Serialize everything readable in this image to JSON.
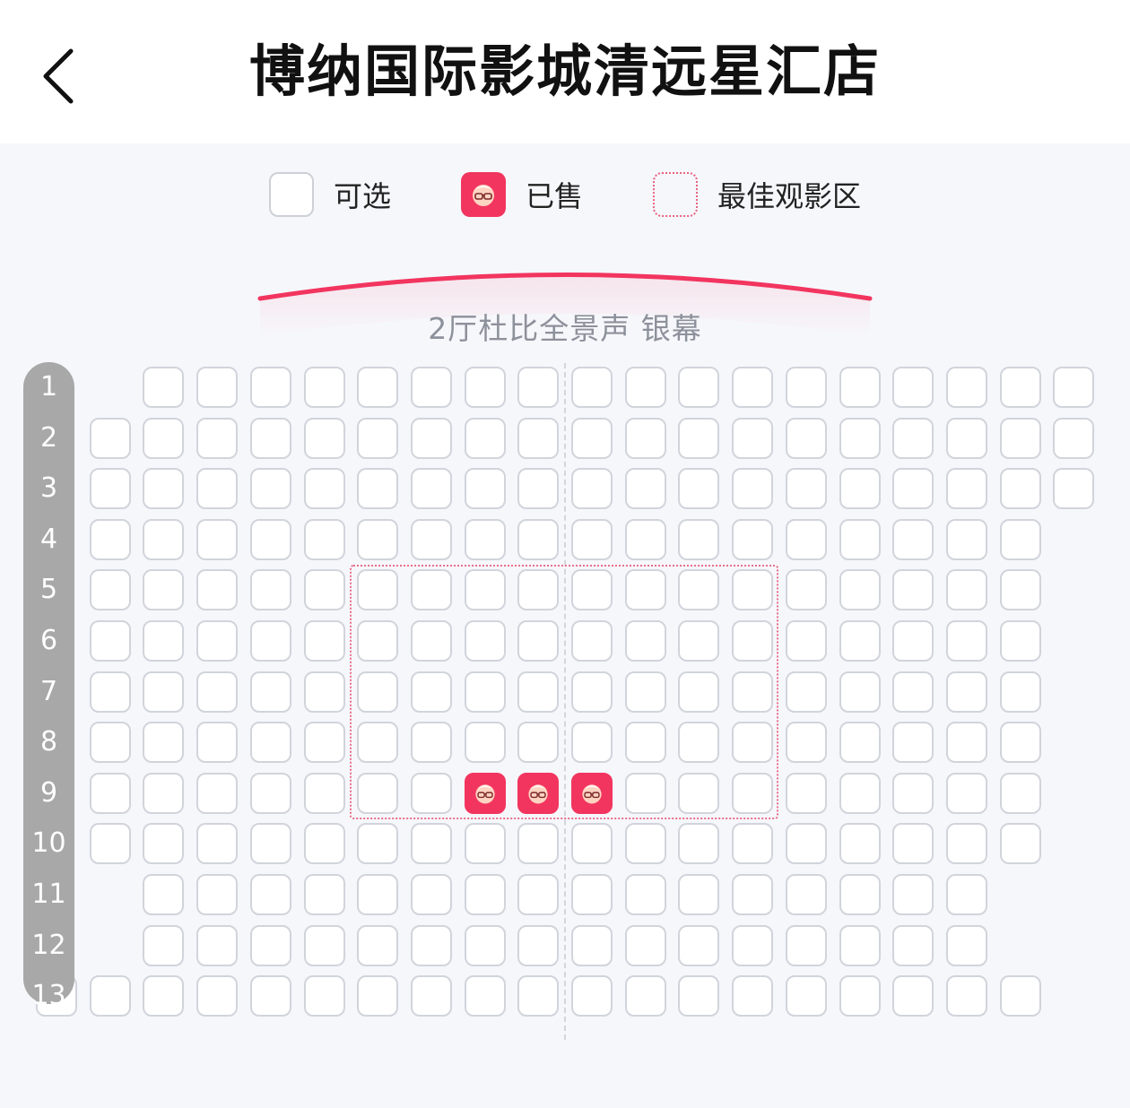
{
  "header": {
    "title": "博纳国际影城清远星汇店",
    "back_icon": "chevron-left-icon"
  },
  "legend": {
    "available_label": "可选",
    "sold_label": "已售",
    "best_area_label": "最佳观影区"
  },
  "screen": {
    "label": "2厅杜比全景声 银幕",
    "accent_color": "#f2355f"
  },
  "colors": {
    "sold": "#f2355f",
    "seat_border": "#d1d4db",
    "row_bar": "#a8a8a8",
    "best_zone": "#e8708a"
  },
  "rows": [
    {
      "label": "1",
      "first_col": 2,
      "last_col": 19,
      "sold": []
    },
    {
      "label": "2",
      "first_col": 1,
      "last_col": 19,
      "sold": []
    },
    {
      "label": "3",
      "first_col": 1,
      "last_col": 19,
      "sold": []
    },
    {
      "label": "4",
      "first_col": 1,
      "last_col": 18,
      "sold": []
    },
    {
      "label": "5",
      "first_col": 1,
      "last_col": 18,
      "sold": []
    },
    {
      "label": "6",
      "first_col": 1,
      "last_col": 18,
      "sold": []
    },
    {
      "label": "7",
      "first_col": 1,
      "last_col": 18,
      "sold": []
    },
    {
      "label": "8",
      "first_col": 1,
      "last_col": 18,
      "sold": []
    },
    {
      "label": "9",
      "first_col": 1,
      "last_col": 18,
      "sold": [
        8,
        9,
        10
      ]
    },
    {
      "label": "10",
      "first_col": 1,
      "last_col": 18,
      "sold": []
    },
    {
      "label": "11",
      "first_col": 2,
      "last_col": 17,
      "sold": []
    },
    {
      "label": "12",
      "first_col": 2,
      "last_col": 17,
      "sold": []
    },
    {
      "label": "13",
      "first_col": 0,
      "last_col": 18,
      "sold": []
    }
  ]
}
